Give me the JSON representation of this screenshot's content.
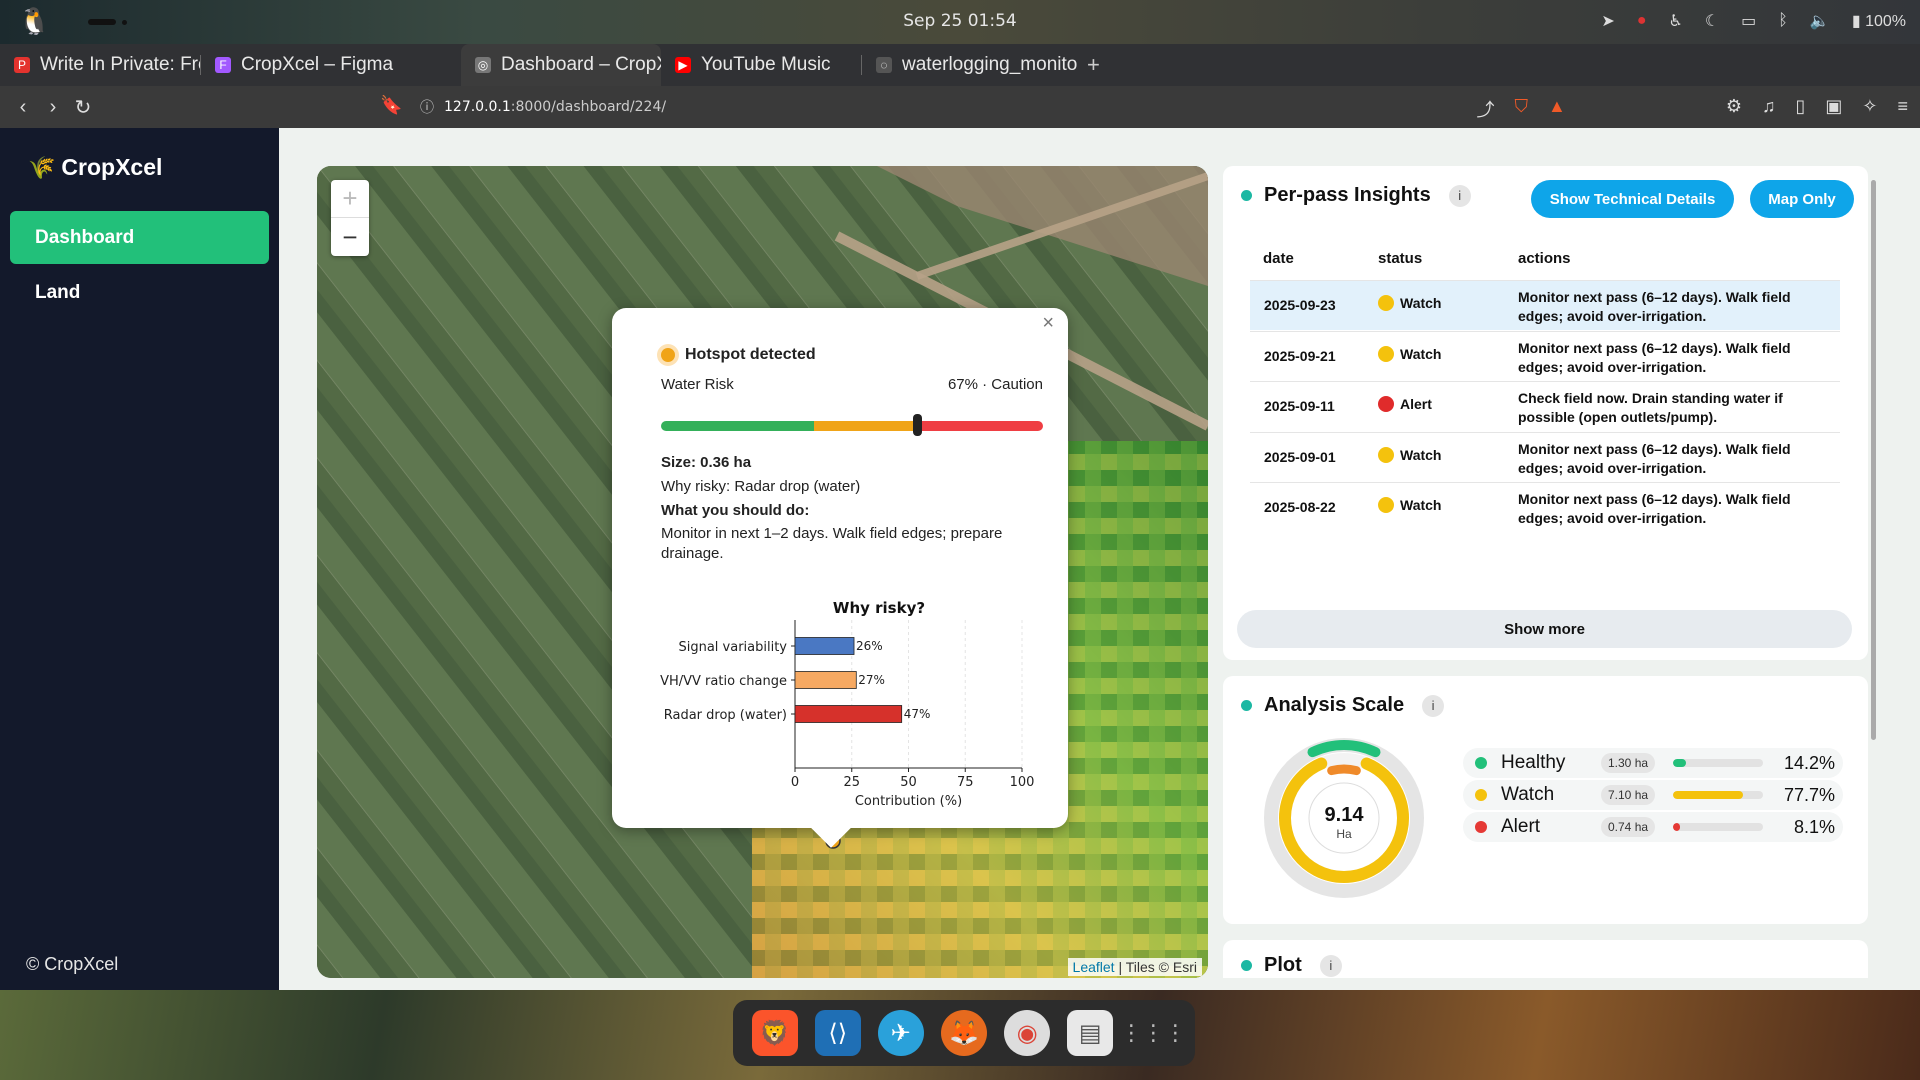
{
  "system": {
    "clock": "Sep 25  01:54",
    "battery": "100%"
  },
  "tabs": [
    {
      "label": "Write In Private: Free Onli",
      "fav_color": "#e4332e",
      "fav_glyph": "P"
    },
    {
      "label": "CropXcel – Figma",
      "fav_color": "#a259ff",
      "fav_glyph": "F"
    },
    {
      "label": "Dashboard – CropXcel",
      "fav_color": "#777",
      "fav_glyph": "◎",
      "active": true
    },
    {
      "label": "YouTube Music",
      "fav_color": "#ff0000",
      "fav_glyph": "▶"
    },
    {
      "label": "waterlogging_monitoring_",
      "fav_color": "#555",
      "fav_glyph": "◌"
    }
  ],
  "address": {
    "host": "127.0.0.1",
    "path": ":8000/dashboard/224/"
  },
  "sidebar": {
    "brand": "CropXcel",
    "items": [
      {
        "label": "Dashboard",
        "active": true
      },
      {
        "label": "Land",
        "active": false
      }
    ],
    "copyright": "© CropXcel"
  },
  "map": {
    "attribution_leaflet": "Leaflet",
    "attribution_tiles": " | Tiles © Esri"
  },
  "popup": {
    "title": "Hotspot detected",
    "risk_label": "Water Risk",
    "risk_value": "67% · Caution",
    "risk_fraction": 0.67,
    "size": "Size: 0.36 ha",
    "why": "Why risky: Radar drop (water)",
    "todo_heading": "What you should do:",
    "todo_text": "Monitor in next 1–2 days. Walk field edges; prepare drainage."
  },
  "chart_data": {
    "type": "bar",
    "orientation": "horizontal",
    "title": "Why risky?",
    "xlabel": "Contribution (%)",
    "categories": [
      "Signal variability",
      "VH/VV ratio change",
      "Radar drop (water)"
    ],
    "values": [
      26,
      27,
      47
    ],
    "value_labels": [
      "26%",
      "27%",
      "47%"
    ],
    "colors": [
      "#4a78c3",
      "#f6a962",
      "#d6312b"
    ],
    "xlim": [
      0,
      100
    ],
    "xticks": [
      "0",
      "25",
      "50",
      "75",
      "100"
    ]
  },
  "insights": {
    "title": "Per-pass Insights",
    "btn_technical": "Show Technical Details",
    "btn_map_only": "Map Only",
    "columns": [
      "date",
      "status",
      "actions"
    ],
    "rows": [
      {
        "date": "2025-09-23",
        "status": "Watch",
        "color": "#f4c20d",
        "action": "Monitor next pass (6–12 days). Walk field edges; avoid over-irrigation."
      },
      {
        "date": "2025-09-21",
        "status": "Watch",
        "color": "#f4c20d",
        "action": "Monitor next pass (6–12 days). Walk field edges; avoid over-irrigation."
      },
      {
        "date": "2025-09-11",
        "status": "Alert",
        "color": "#e02b2b",
        "action": "Check field now. Drain standing water if possible (open outlets/pump)."
      },
      {
        "date": "2025-09-01",
        "status": "Watch",
        "color": "#f4c20d",
        "action": "Monitor next pass (6–12 days). Walk field edges; avoid over-irrigation."
      },
      {
        "date": "2025-08-22",
        "status": "Watch",
        "color": "#f4c20d",
        "action": "Monitor next pass (6–12 days). Walk field edges; avoid over-irrigation."
      }
    ],
    "show_more": "Show more"
  },
  "analysis": {
    "title": "Analysis Scale",
    "total": "9.14",
    "unit": "Ha",
    "items": [
      {
        "name": "Healthy",
        "ha": "1.30 ha",
        "pct": "14.2%",
        "fraction": 0.142,
        "color": "#22c07a"
      },
      {
        "name": "Watch",
        "ha": "7.10 ha",
        "pct": "77.7%",
        "fraction": 0.777,
        "color": "#f4c20d"
      },
      {
        "name": "Alert",
        "ha": "0.74 ha",
        "pct": "8.1%",
        "fraction": 0.081,
        "color": "#e53935"
      }
    ]
  },
  "plot": {
    "title": "Plot"
  }
}
